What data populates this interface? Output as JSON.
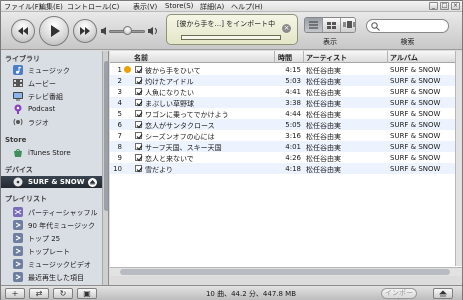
{
  "menu": {
    "items": [
      "ファイル(F)",
      "編集(E)",
      "コントロール(C)",
      "表示(V)",
      "Store(S)",
      "詳細(A)",
      "ヘルプ(H)"
    ]
  },
  "window_controls": {
    "minimize": "_",
    "maximize": "□",
    "close": "×"
  },
  "lcd": {
    "message": "[彼から手を...] をインポート中",
    "progress": 0.0
  },
  "toolbar": {
    "view_label": "表示",
    "search_label": "検索",
    "search_value": ""
  },
  "sidebar": {
    "sections": [
      {
        "title": "ライブラリ",
        "items": [
          {
            "label": "ミュージック",
            "icon": "music-note-icon"
          },
          {
            "label": "ムービー",
            "icon": "movie-icon"
          },
          {
            "label": "テレビ番組",
            "icon": "tv-icon"
          },
          {
            "label": "Podcast",
            "icon": "podcast-icon"
          },
          {
            "label": "ラジオ",
            "icon": "radio-icon"
          }
        ]
      },
      {
        "title": "Store",
        "items": [
          {
            "label": "iTunes Store",
            "icon": "store-icon"
          }
        ]
      },
      {
        "title": "デバイス",
        "items": [
          {
            "label": "SURF & SNOW",
            "icon": "cd-icon",
            "selected": true
          }
        ]
      },
      {
        "title": "プレイリスト",
        "items": [
          {
            "label": "パーティーシャッフル",
            "icon": "party-shuffle-icon"
          },
          {
            "label": "90 年代ミュージック",
            "icon": "smart-playlist-icon"
          },
          {
            "label": "トップ 25",
            "icon": "smart-playlist-icon"
          },
          {
            "label": "トップレート",
            "icon": "smart-playlist-icon"
          },
          {
            "label": "ミュージックビデオ",
            "icon": "smart-playlist-icon"
          },
          {
            "label": "最近再生した項目",
            "icon": "smart-playlist-icon"
          }
        ]
      }
    ]
  },
  "tracklist": {
    "headers": {
      "name": "名前",
      "time": "時間",
      "artist": "アーティスト",
      "album": "アルバム"
    },
    "rows": [
      {
        "num": "1",
        "name": "彼から手をひいて",
        "time": "4:15",
        "artist": "松任谷由実",
        "album": "SURF & SNOW",
        "importing": true
      },
      {
        "num": "2",
        "name": "灼けたアイドル",
        "time": "5:03",
        "artist": "松任谷由実",
        "album": "SURF & SNOW"
      },
      {
        "num": "3",
        "name": "人魚になりたい",
        "time": "4:41",
        "artist": "松任谷由実",
        "album": "SURF & SNOW"
      },
      {
        "num": "4",
        "name": "まぶしい草野球",
        "time": "3:38",
        "artist": "松任谷由実",
        "album": "SURF & SNOW"
      },
      {
        "num": "5",
        "name": "ワゴンに乗ってでかけよう",
        "time": "4:44",
        "artist": "松任谷由実",
        "album": "SURF & SNOW"
      },
      {
        "num": "6",
        "name": "恋人がサンタクロース",
        "time": "5:05",
        "artist": "松任谷由実",
        "album": "SURF & SNOW"
      },
      {
        "num": "7",
        "name": "シーズンオフの心には",
        "time": "3:16",
        "artist": "松任谷由実",
        "album": "SURF & SNOW"
      },
      {
        "num": "8",
        "name": "サーフ天国、スキー天国",
        "time": "4:01",
        "artist": "松任谷由実",
        "album": "SURF & SNOW"
      },
      {
        "num": "9",
        "name": "恋人と来ないで",
        "time": "4:26",
        "artist": "松任谷由実",
        "album": "SURF & SNOW"
      },
      {
        "num": "10",
        "name": "雪だより",
        "time": "4:18",
        "artist": "松任谷由実",
        "album": "SURF & SNOW"
      }
    ]
  },
  "status": {
    "summary": "10 曲、44.2 分、447.8 MB",
    "import_label": "インポート"
  },
  "bottom_buttons": {
    "add": "+",
    "shuffle": "⇄",
    "repeat": "↻",
    "artwork": "▣",
    "eject": "⏏"
  }
}
